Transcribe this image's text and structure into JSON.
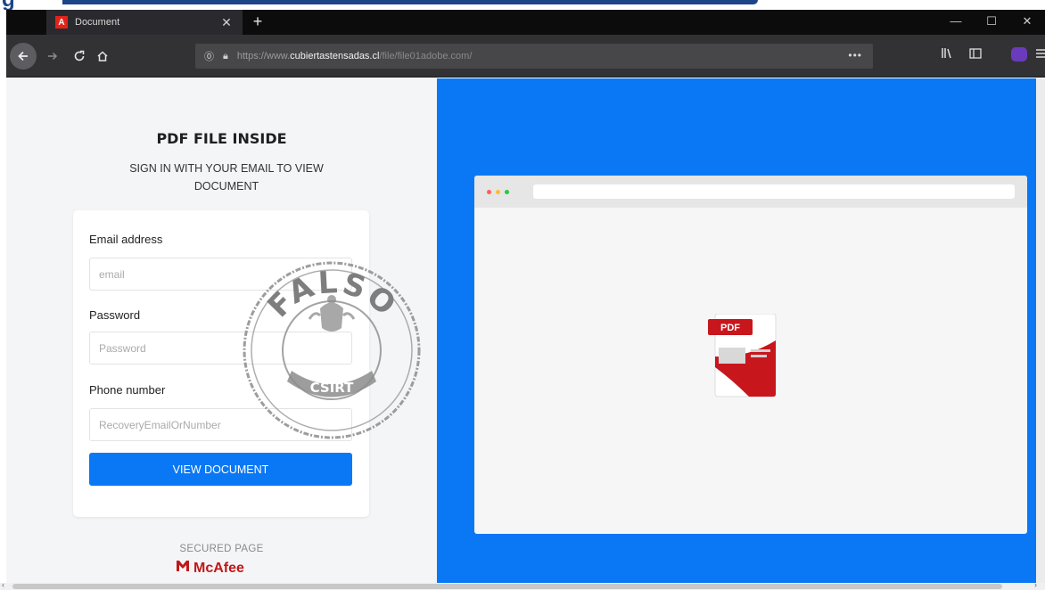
{
  "browser": {
    "tab_title": "Document",
    "tab_favicon": "A",
    "tab_close": "✕",
    "new_tab": "+",
    "url_prefix": "https://www.",
    "url_domain": "cubiertastensadas.cl",
    "url_path": "/file/file01adobe.com/",
    "url_more": "•••",
    "window_minimize": "—",
    "window_maximize": "☐",
    "window_close": "✕",
    "nav_icons": {
      "back": "arrow-left-icon",
      "forward": "arrow-right-icon",
      "reload": "reload-icon",
      "home": "home-icon",
      "library": "library-icon",
      "sidebar": "sidebar-icon",
      "extension": "extension-icon",
      "menu": "hamburger-menu-icon"
    }
  },
  "page": {
    "headline": "PDF FILE INSIDE",
    "subheadline": "SIGN IN WITH YOUR EMAIL TO VIEW DOCUMENT",
    "form": {
      "email_label": "Email address",
      "email_placeholder": "email",
      "password_label": "Password",
      "password_placeholder": "Password",
      "phone_label": "Phone number",
      "phone_placeholder": "RecoveryEmailOrNumber",
      "submit_label": "VIEW DOCUMENT"
    },
    "secured_text": "SECURED PAGE",
    "mcafee_brand": "McAfee",
    "pdf_badge": "PDF"
  },
  "stamp": {
    "word": "FALSO",
    "org": "CSIRT"
  },
  "colors": {
    "accent": "#0a78f5",
    "pdf_red": "#c8161d",
    "stamp_gray": "#8c8c8c",
    "mcafee_red": "#c01818"
  },
  "top_deco_text": "g"
}
